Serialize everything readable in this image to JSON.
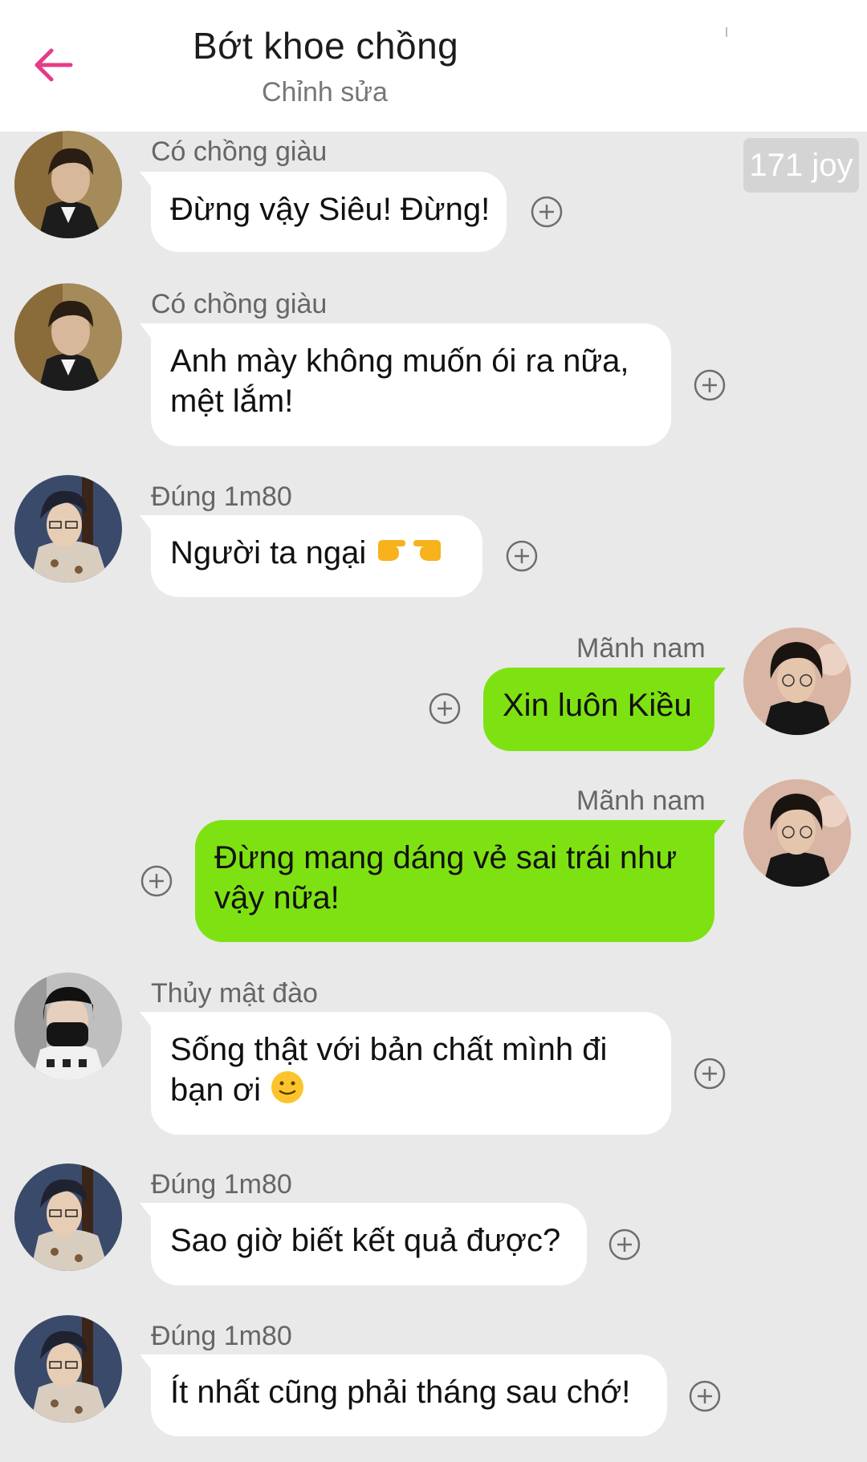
{
  "header": {
    "title": "Bớt khoe chồng",
    "subtitle": "Chỉnh sửa",
    "back_icon": "arrow-left-icon",
    "accent_color": "#e63c87"
  },
  "joy_badge": "171 joy",
  "colors": {
    "background": "#e9e9e9",
    "incoming_bubble": "#ffffff",
    "outgoing_bubble": "#7ee212"
  },
  "messages": [
    {
      "direction": "in",
      "sender": "Có chồng giàu",
      "text": "Đừng vậy Siêu! Đừng!"
    },
    {
      "direction": "in",
      "sender": "Có chồng giàu",
      "text": "Anh mày không muốn ói ra nữa, mệt lắm!"
    },
    {
      "direction": "in",
      "sender": "Đúng 1m80",
      "text": "Người ta ngại",
      "emoji": "pointing-fingers-emoji"
    },
    {
      "direction": "out",
      "sender": "Mãnh nam",
      "text": "Xin luôn Kiều"
    },
    {
      "direction": "out",
      "sender": "Mãnh nam",
      "text": "Đừng mang dáng vẻ sai trái như vậy nữa!"
    },
    {
      "direction": "in",
      "sender": "Thủy mật đào",
      "text": "Sống thật với bản chất mình đi bạn ơi",
      "emoji": "slightly-smiling-face-emoji"
    },
    {
      "direction": "in",
      "sender": "Đúng 1m80",
      "text": "Sao giờ biết kết quả được?"
    },
    {
      "direction": "in",
      "sender": "Đúng 1m80",
      "text": "Ít nhất cũng phải tháng sau chớ!"
    }
  ]
}
